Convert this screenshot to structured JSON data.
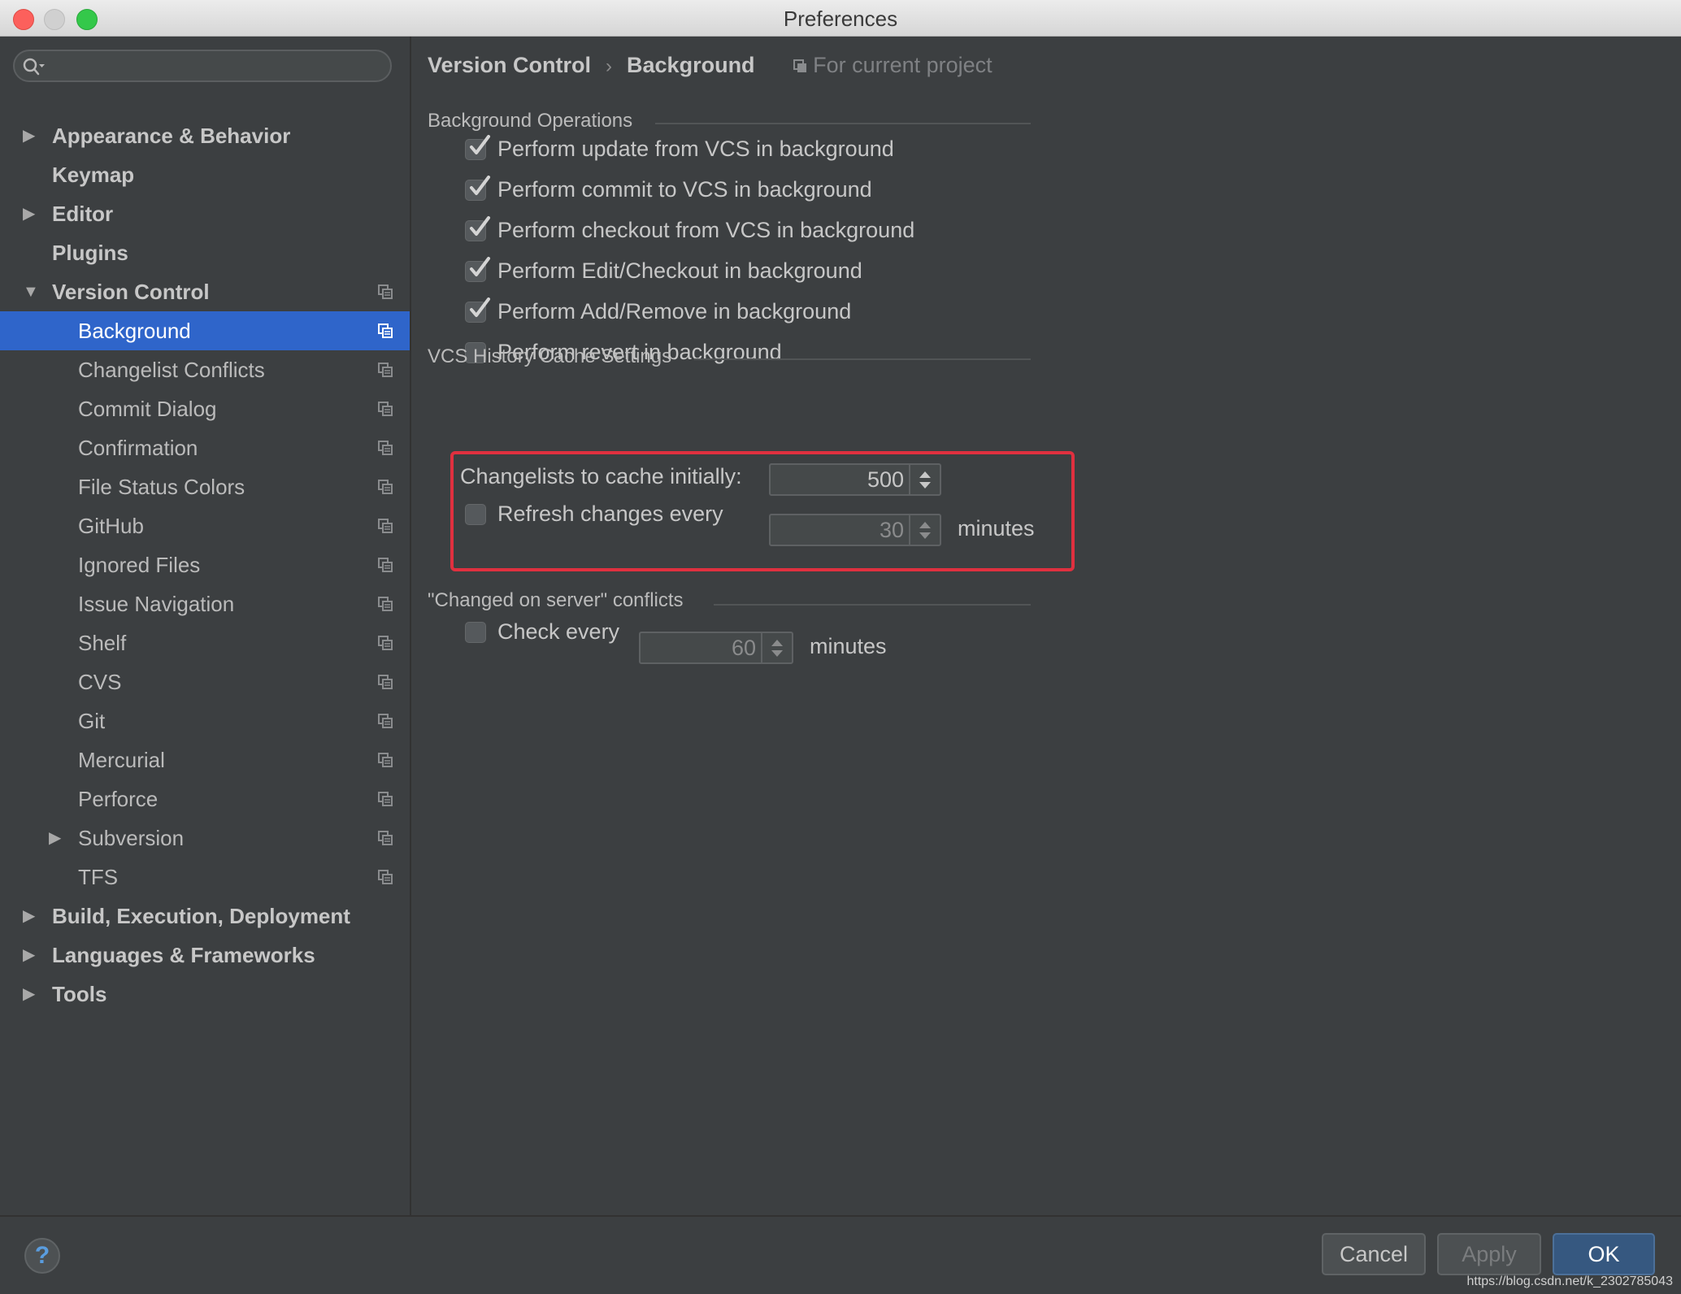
{
  "window": {
    "title": "Preferences"
  },
  "sidebar": {
    "search_placeholder": "",
    "items": [
      {
        "label": "Appearance & Behavior",
        "level": 0,
        "arrow": "right",
        "bold": true,
        "project_icon": false,
        "selected": false
      },
      {
        "label": "Keymap",
        "level": 0,
        "arrow": "",
        "bold": true,
        "project_icon": false,
        "selected": false
      },
      {
        "label": "Editor",
        "level": 0,
        "arrow": "right",
        "bold": true,
        "project_icon": false,
        "selected": false
      },
      {
        "label": "Plugins",
        "level": 0,
        "arrow": "",
        "bold": true,
        "project_icon": false,
        "selected": false
      },
      {
        "label": "Version Control",
        "level": 0,
        "arrow": "down",
        "bold": true,
        "project_icon": true,
        "selected": false
      },
      {
        "label": "Background",
        "level": 1,
        "arrow": "",
        "bold": false,
        "project_icon": true,
        "selected": true
      },
      {
        "label": "Changelist Conflicts",
        "level": 1,
        "arrow": "",
        "bold": false,
        "project_icon": true,
        "selected": false
      },
      {
        "label": "Commit Dialog",
        "level": 1,
        "arrow": "",
        "bold": false,
        "project_icon": true,
        "selected": false
      },
      {
        "label": "Confirmation",
        "level": 1,
        "arrow": "",
        "bold": false,
        "project_icon": true,
        "selected": false
      },
      {
        "label": "File Status Colors",
        "level": 1,
        "arrow": "",
        "bold": false,
        "project_icon": true,
        "selected": false
      },
      {
        "label": "GitHub",
        "level": 1,
        "arrow": "",
        "bold": false,
        "project_icon": true,
        "selected": false
      },
      {
        "label": "Ignored Files",
        "level": 1,
        "arrow": "",
        "bold": false,
        "project_icon": true,
        "selected": false
      },
      {
        "label": "Issue Navigation",
        "level": 1,
        "arrow": "",
        "bold": false,
        "project_icon": true,
        "selected": false
      },
      {
        "label": "Shelf",
        "level": 1,
        "arrow": "",
        "bold": false,
        "project_icon": true,
        "selected": false
      },
      {
        "label": "CVS",
        "level": 1,
        "arrow": "",
        "bold": false,
        "project_icon": true,
        "selected": false
      },
      {
        "label": "Git",
        "level": 1,
        "arrow": "",
        "bold": false,
        "project_icon": true,
        "selected": false
      },
      {
        "label": "Mercurial",
        "level": 1,
        "arrow": "",
        "bold": false,
        "project_icon": true,
        "selected": false
      },
      {
        "label": "Perforce",
        "level": 1,
        "arrow": "",
        "bold": false,
        "project_icon": true,
        "selected": false
      },
      {
        "label": "Subversion",
        "level": 1,
        "arrow": "right",
        "bold": false,
        "project_icon": true,
        "selected": false
      },
      {
        "label": "TFS",
        "level": 1,
        "arrow": "",
        "bold": false,
        "project_icon": true,
        "selected": false
      },
      {
        "label": "Build, Execution, Deployment",
        "level": 0,
        "arrow": "right",
        "bold": true,
        "project_icon": false,
        "selected": false
      },
      {
        "label": "Languages & Frameworks",
        "level": 0,
        "arrow": "right",
        "bold": true,
        "project_icon": false,
        "selected": false
      },
      {
        "label": "Tools",
        "level": 0,
        "arrow": "right",
        "bold": true,
        "project_icon": false,
        "selected": false
      }
    ]
  },
  "breadcrumb": {
    "parent": "Version Control",
    "separator": "›",
    "current": "Background",
    "scope_hint": "For current project"
  },
  "background_operations": {
    "title": "Background Operations",
    "checkboxes": [
      {
        "label": "Perform update from VCS in background",
        "checked": true
      },
      {
        "label": "Perform commit to VCS in background",
        "checked": true
      },
      {
        "label": "Perform checkout from VCS in background",
        "checked": true
      },
      {
        "label": "Perform Edit/Checkout in background",
        "checked": true
      },
      {
        "label": "Perform Add/Remove in background",
        "checked": true
      },
      {
        "label": "Perform revert in background",
        "checked": false
      }
    ]
  },
  "history_cache": {
    "title": "VCS History Cache Settings",
    "changelists_label": "Changelists to cache initially:",
    "changelists_value": "500",
    "refresh_label": "Refresh changes every",
    "refresh_checked": false,
    "refresh_value": "30",
    "refresh_unit": "minutes"
  },
  "server_conflicts": {
    "title": "\"Changed on server\" conflicts",
    "check_label": "Check every",
    "check_checked": false,
    "check_value": "60",
    "check_unit": "minutes"
  },
  "footer": {
    "help_label": "?",
    "cancel_label": "Cancel",
    "apply_label": "Apply",
    "ok_label": "OK",
    "watermark": "https://blog.csdn.net/k_2302785043"
  },
  "colors": {
    "selection": "#2f65ca",
    "highlight_border": "#e0303f",
    "ok_button": "#365880"
  }
}
